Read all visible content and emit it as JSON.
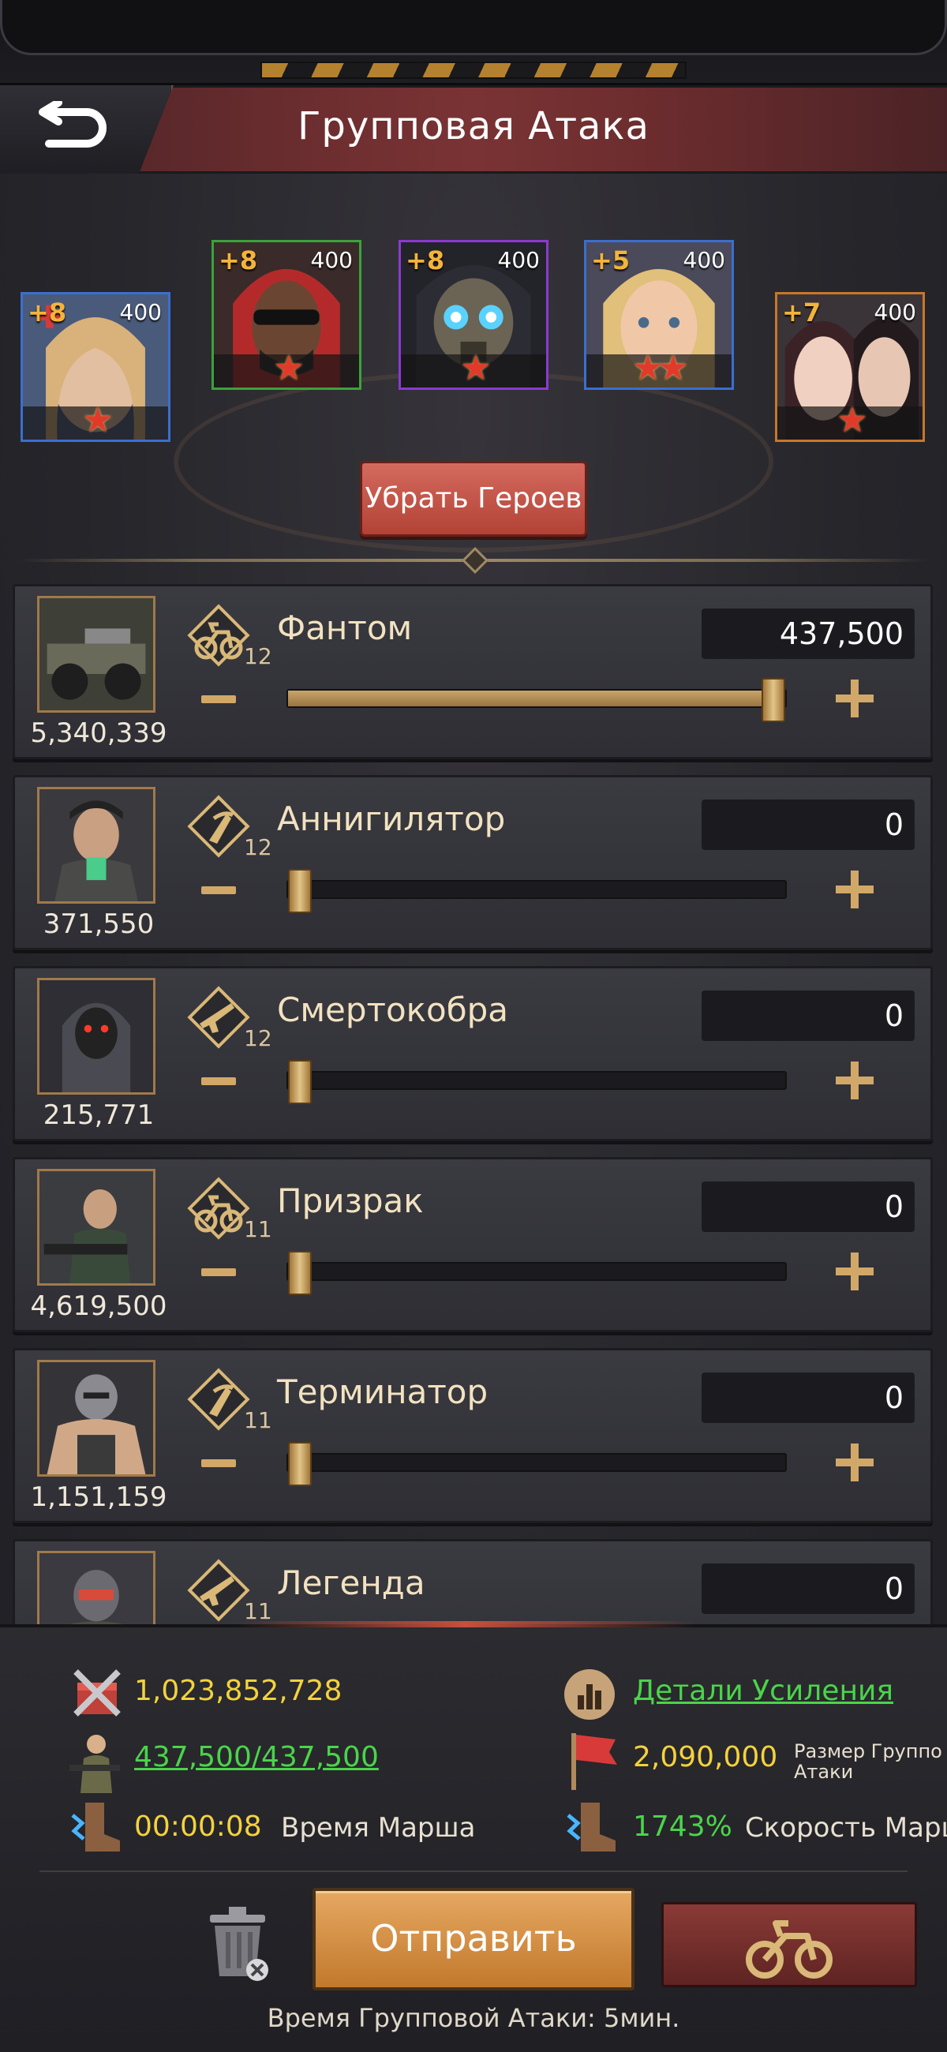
{
  "header": {
    "title": "Групповая Атака"
  },
  "heroes": [
    {
      "level": "+8",
      "power": "400",
      "stars": 1,
      "frame": "#3a6fd0"
    },
    {
      "level": "+8",
      "power": "400",
      "stars": 1,
      "frame": "#3aa33a"
    },
    {
      "level": "+8",
      "power": "400",
      "stars": 1,
      "frame": "#8a3ad0"
    },
    {
      "level": "+5",
      "power": "400",
      "stars": 2,
      "frame": "#3a6fd0"
    },
    {
      "level": "+7",
      "power": "400",
      "stars": 1,
      "frame": "#c8772a"
    }
  ],
  "remove_heroes_label": "Убрать Героев",
  "units": [
    {
      "name": "Фантом",
      "tier": "12",
      "count": "5,340,339",
      "value": "437,500",
      "level": 1.0,
      "type_icon": "motorcycle-icon"
    },
    {
      "name": "Аннигилятор",
      "tier": "12",
      "count": "371,550",
      "value": "0",
      "level": 0,
      "type_icon": "rocket-icon"
    },
    {
      "name": "Смертокобра",
      "tier": "12",
      "count": "215,771",
      "value": "0",
      "level": 0,
      "type_icon": "rifle-icon"
    },
    {
      "name": "Призрак",
      "tier": "11",
      "count": "4,619,500",
      "value": "0",
      "level": 0,
      "type_icon": "motorcycle-icon"
    },
    {
      "name": "Терминатор",
      "tier": "11",
      "count": "1,151,159",
      "value": "0",
      "level": 0,
      "type_icon": "rocket-icon"
    },
    {
      "name": "Легенда",
      "tier": "11",
      "count": "",
      "value": "0",
      "level": 0,
      "type_icon": "rifle-icon"
    }
  ],
  "stats": {
    "power": "1,023,852,728",
    "boost_details": "Детали Усиления",
    "troops": "437,500/437,500",
    "rally_size_value": "2,090,000",
    "rally_size_label_1": "Размер Группо",
    "rally_size_label_2": "Атаки",
    "march_time": "00:00:08",
    "march_time_label": "Время Марша",
    "speed_value": "1743%",
    "speed_label": "Скорость Марш"
  },
  "send_label": "Отправить",
  "footer": "Время Групповой Атаки: 5мин."
}
